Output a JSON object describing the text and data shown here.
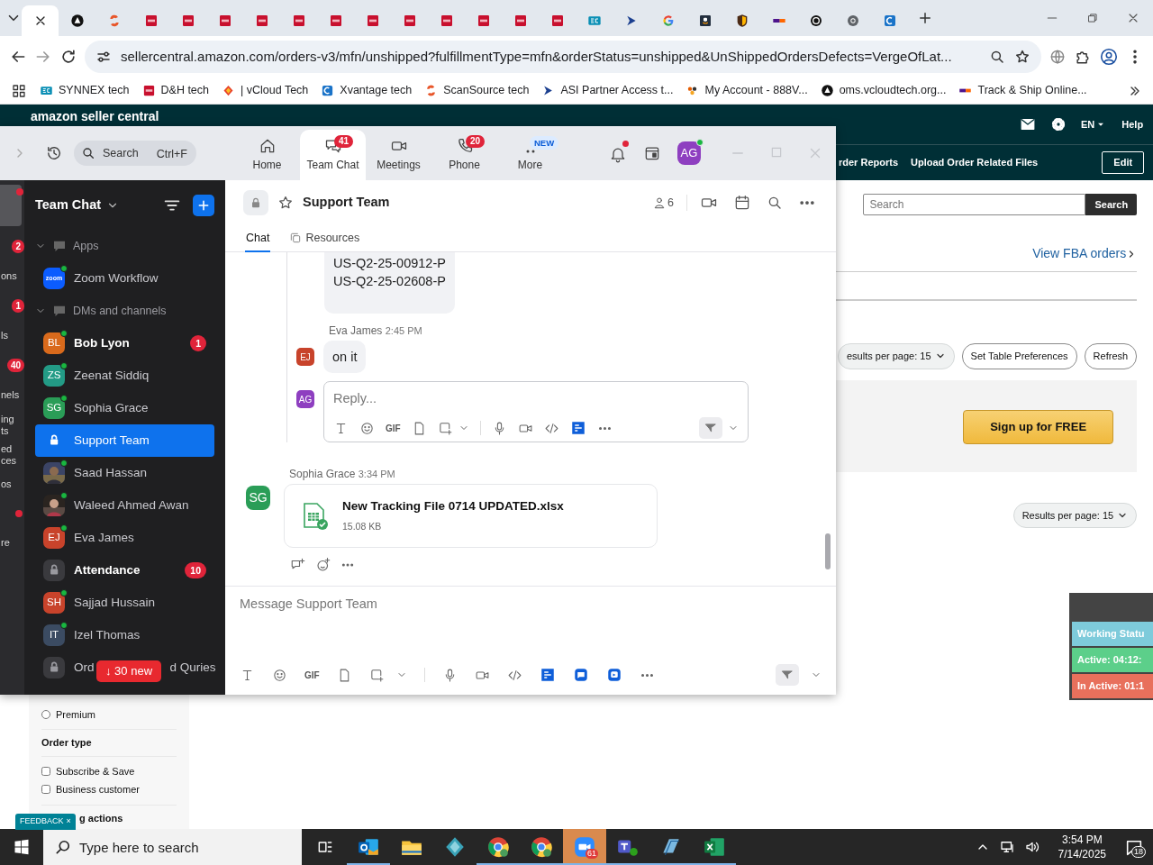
{
  "browser": {
    "tabs": [
      {
        "kind": "close",
        "selected": true
      },
      {
        "kind": "circle",
        "selected": false
      },
      {
        "kind": "swirl",
        "selected": false
      },
      {
        "kind": "dh",
        "selected": false
      },
      {
        "kind": "dh",
        "selected": false
      },
      {
        "kind": "dh",
        "selected": false
      },
      {
        "kind": "dh",
        "selected": false
      },
      {
        "kind": "dh",
        "selected": false
      },
      {
        "kind": "dh",
        "selected": false
      },
      {
        "kind": "dh",
        "selected": false
      },
      {
        "kind": "dh",
        "selected": false
      },
      {
        "kind": "dh",
        "selected": false
      },
      {
        "kind": "dh",
        "selected": false
      },
      {
        "kind": "dh",
        "selected": false
      },
      {
        "kind": "dh",
        "selected": false
      },
      {
        "kind": "ec",
        "selected": false
      },
      {
        "kind": "play",
        "selected": false
      },
      {
        "kind": "g",
        "selected": false
      },
      {
        "kind": "a",
        "selected": false
      },
      {
        "kind": "ups",
        "selected": false
      },
      {
        "kind": "fedex",
        "selected": false
      },
      {
        "kind": "ring",
        "selected": false
      },
      {
        "kind": "chrome",
        "selected": false
      },
      {
        "kind": "cloud",
        "selected": false
      }
    ],
    "address": "sellercentral.amazon.com/orders-v3/mfn/unshipped?fulfillmentType=mfn&orderStatus=unshipped&UnShippedOrdersDefects=VergeOfLat...",
    "bookmarks": [
      {
        "label": "SYNNEX tech",
        "kind": "ec"
      },
      {
        "label": "D&H tech",
        "kind": "dh"
      },
      {
        "label": "| vCloud Tech",
        "kind": "diamond"
      },
      {
        "label": "Xvantage tech",
        "kind": "cloud"
      },
      {
        "label": "ScanSource tech",
        "kind": "swirl"
      },
      {
        "label": "ASI Partner Access t...",
        "kind": "play"
      },
      {
        "label": "My Account - 888V...",
        "kind": "dots"
      },
      {
        "label": "oms.vcloudtech.org...",
        "kind": "circle"
      },
      {
        "label": "Track & Ship Online...",
        "kind": "fedex"
      }
    ]
  },
  "seller_central": {
    "brand": "amazon seller central",
    "language": "EN",
    "help": "Help",
    "nav": [
      "rder Reports",
      "Upload Order Related Files"
    ],
    "edit": "Edit",
    "search": {
      "placeholder": "Search",
      "button": "Search"
    },
    "fba_link": "View FBA orders",
    "results_top": "esults per page: 15",
    "table_prefs": "Set Table Preferences",
    "refresh": "Refresh",
    "signup": "Sign up for FREE",
    "results_bottom": "Results per page: 15",
    "filters": [
      {
        "kind": "radio",
        "label": "Premium",
        "checked": false
      },
      {
        "kind": "heading",
        "label": "Order type"
      },
      {
        "kind": "checkbox",
        "label": "Subscribe & Save",
        "checked": false
      },
      {
        "kind": "checkbox",
        "label": "Business customer",
        "checked": false
      },
      {
        "kind": "heading",
        "label": "g actions"
      }
    ],
    "feedback": "FEEDBACK",
    "feedback_close": "×"
  },
  "status_widget": {
    "rows": [
      {
        "label": "Working Statu",
        "color": "#7ecbdb"
      },
      {
        "label": "Active: 04:12:",
        "color": "#5ccf8a"
      },
      {
        "label": "In Active: 01:1",
        "color": "#e8705c"
      }
    ]
  },
  "zoom": {
    "rail": [
      {
        "kind": "badge",
        "text": "2"
      },
      {
        "kind": "label",
        "text": "ons"
      },
      {
        "kind": "badge",
        "text": "1"
      },
      {
        "kind": "label",
        "text": "ls"
      },
      {
        "kind": "badge",
        "text": "40"
      },
      {
        "kind": "label",
        "text": "nels"
      },
      {
        "kind": "label",
        "text": "ing ts"
      },
      {
        "kind": "label",
        "text": "ed ces"
      },
      {
        "kind": "label",
        "text": "os"
      },
      {
        "kind": "dot"
      },
      {
        "kind": "label",
        "text": "re"
      }
    ],
    "search": {
      "placeholder": "Search",
      "shortcut": "Ctrl+F"
    },
    "tabs": [
      {
        "label": "Home",
        "kind": "home",
        "selected": false
      },
      {
        "label": "Team Chat",
        "kind": "chat",
        "badge": "41",
        "selected": true
      },
      {
        "label": "Meetings",
        "kind": "video",
        "selected": false
      },
      {
        "label": "Phone",
        "kind": "phone",
        "badge": "20",
        "selected": false
      },
      {
        "label": "More",
        "kind": "more",
        "tag": "NEW",
        "selected": false
      }
    ],
    "user_initials": "AG",
    "sidebar": {
      "title": "Team Chat",
      "sections": [
        {
          "label": "Apps",
          "expanded": true,
          "items": [
            {
              "kind": "app",
              "name": "Zoom Workflow",
              "initials": "zoom",
              "online": true,
              "unread": false,
              "selected": false
            }
          ]
        },
        {
          "label": "DMs and channels",
          "expanded": true,
          "items": [
            {
              "kind": "person",
              "name": "Bob Lyon",
              "initials": "BL",
              "color": "#d96a1c",
              "online": true,
              "unread": true,
              "badge": "1",
              "selected": false
            },
            {
              "kind": "person",
              "name": "Zeenat Siddiq",
              "initials": "ZS",
              "color": "#239b86",
              "online": true,
              "unread": false,
              "selected": false
            },
            {
              "kind": "person",
              "name": "Sophia Grace",
              "initials": "SG",
              "color": "#2a9d57",
              "online": true,
              "unread": false,
              "selected": false
            },
            {
              "kind": "channel",
              "name": "Support Team",
              "unread": false,
              "selected": true
            },
            {
              "name": "Saad Hassan",
              "online": true,
              "unread": false,
              "selected": false
            },
            {
              "name": "Waleed Ahmed Awan",
              "online": true,
              "unread": false,
              "selected": false
            },
            {
              "kind": "person",
              "name": "Eva James",
              "initials": "EJ",
              "color": "#c8432b",
              "online": true,
              "unread": false,
              "selected": false
            },
            {
              "kind": "channel",
              "name": "Attendance",
              "unread": true,
              "badge": "10",
              "selected": false
            },
            {
              "kind": "person",
              "name": "Sajjad Hussain",
              "initials": "SH",
              "color": "#c8432b",
              "online": true,
              "unread": false,
              "selected": false
            },
            {
              "kind": "person",
              "name": "Izel Thomas",
              "initials": "IT",
              "color": "#3b4b62",
              "online": true,
              "unread": false,
              "selected": false
            },
            {
              "kind": "channel",
              "name": "Ord",
              "name_tail": "d Quries",
              "unread": false,
              "selected": false
            }
          ]
        }
      ],
      "new_pill": "↓ 30 new"
    },
    "chat": {
      "title": "Support Team",
      "members": "6",
      "tabs": [
        {
          "label": "Chat",
          "selected": true
        },
        {
          "label": "Resources",
          "selected": false
        }
      ],
      "thread": [
        {
          "kind": "lines",
          "lines": [
            "US-Q2-25-00912-P",
            "US-Q2-25-02608-P"
          ]
        },
        {
          "kind": "text",
          "sender": "Eva James",
          "time": "2:45 PM",
          "initials": "EJ",
          "color": "#c8432b",
          "text": "on it"
        },
        {
          "kind": "reply",
          "initials": "AG",
          "color": "#8e3fc0",
          "placeholder": "Reply..."
        }
      ],
      "reply_tools": [
        {
          "kind": "format"
        },
        {
          "kind": "emoji"
        },
        {
          "kind": "gif",
          "label": "GIF"
        },
        {
          "kind": "file"
        },
        {
          "kind": "shot"
        },
        {
          "kind": "caret"
        },
        {
          "kind": "sep"
        },
        {
          "kind": "mic"
        },
        {
          "kind": "video"
        },
        {
          "kind": "code"
        },
        {
          "kind": "app_doc"
        },
        {
          "kind": "more"
        },
        {
          "kind": "send"
        },
        {
          "kind": "caret"
        }
      ],
      "file_message": {
        "sender": "Sophia Grace",
        "time": "3:34 PM",
        "initials": "SG",
        "color": "#2a9d57",
        "file": "New Tracking File 0714 UPDATED.xlsx",
        "size": "15.08 KB"
      },
      "composer": {
        "placeholder": "Message Support Team",
        "tools": [
          {
            "kind": "format"
          },
          {
            "kind": "emoji"
          },
          {
            "kind": "gif",
            "label": "GIF"
          },
          {
            "kind": "file"
          },
          {
            "kind": "shot"
          },
          {
            "kind": "caret"
          },
          {
            "kind": "sep"
          },
          {
            "kind": "mic"
          },
          {
            "kind": "video"
          },
          {
            "kind": "code"
          },
          {
            "kind": "app_doc"
          },
          {
            "kind": "app_chat"
          },
          {
            "kind": "app_screen"
          },
          {
            "kind": "more"
          },
          {
            "kind": "send"
          },
          {
            "kind": "caret"
          }
        ]
      }
    }
  },
  "taskbar": {
    "search_placeholder": "Type here to search",
    "apps": [
      {
        "kind": "outlook",
        "running": true,
        "active": false
      },
      {
        "kind": "folder",
        "running": false,
        "active": false
      },
      {
        "kind": "gem",
        "running": false,
        "active": false
      },
      {
        "kind": "chromeC",
        "running": true,
        "active": false
      },
      {
        "kind": "chromeC",
        "running": true,
        "active": false
      },
      {
        "kind": "zoom",
        "running": true,
        "active": true,
        "badge": "61"
      },
      {
        "kind": "teams",
        "running": true,
        "active": false
      },
      {
        "kind": "app",
        "running": true,
        "active": false
      },
      {
        "kind": "excel",
        "running": true,
        "active": false
      }
    ],
    "time": "3:54 PM",
    "date": "7/14/2025",
    "notifications": "18"
  }
}
